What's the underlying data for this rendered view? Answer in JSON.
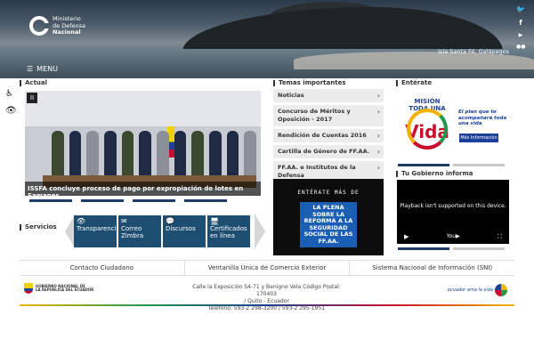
{
  "header": {
    "logo_line1": "Ministerio",
    "logo_line2": "de Defensa",
    "logo_line3": "Nacional",
    "menu_label": "MENU",
    "location": "Isla Santa Fé, Galápagos",
    "social": [
      "t",
      "f",
      "You",
      "flickr"
    ]
  },
  "actual": {
    "title": "Actual",
    "caption": "ISSFA concluye proceso de pago por expropiación de lotes en Samanes",
    "pause": "II"
  },
  "services": {
    "title": "Servicios",
    "items": [
      {
        "label": "Transparencia",
        "icon": "eye-icon"
      },
      {
        "label": "Correo Zimbra",
        "icon": "mail-icon"
      },
      {
        "label": "Discursos",
        "icon": "speech-icon"
      },
      {
        "label": "Certificados en línea",
        "icon": "monitor-icon"
      }
    ]
  },
  "topics": {
    "title": "Temas importantes",
    "items": [
      "Noticias",
      "Concurso de Méritos y Oposición - 2017",
      "Rendición de Cuentas 2016",
      "Cartilla de Género de FF.AA.",
      "FF.AA. e Institutos de la Defensa"
    ]
  },
  "promo": {
    "top": "ENTÉRATE MÁS DE",
    "highlight": "LA PLENA SOBRE LA REFORMA A LA SEGURIDAD SOCIAL DE LAS FF.AA."
  },
  "entrate": {
    "title": "Entérate",
    "mision": "MISIÓN TODA UNA",
    "vida": "Vida",
    "tagline": "El plan que te acompañará toda una vida",
    "button": "Más Información"
  },
  "gov_info": {
    "title": "Tu Gobierno informa",
    "video_msg": "Playback isn't supported on this device."
  },
  "footer_links": [
    "Contacto Ciudadano",
    "Ventanilla Única de Comercio Exterior",
    "Sistema Nacional de Información (SNI)"
  ],
  "footer": {
    "gov_logo_line1": "GOBIERNO NACIONAL DE",
    "gov_logo_line2": "LA REPÚBLICA DEL ECUADOR",
    "address_line1": "Calle la Exposición S4-71 y Benigno Vela Código Postal: 170403",
    "address_line2": "/ Quito - Ecuador",
    "address_line3": "Teléfono: 593-2 298-3200 / 593-2 295-1951",
    "ecuador_text": "ecuador ama la vida"
  },
  "colors": {
    "primary": "#1e4d72",
    "accent_dark": "#1e3a6a"
  }
}
